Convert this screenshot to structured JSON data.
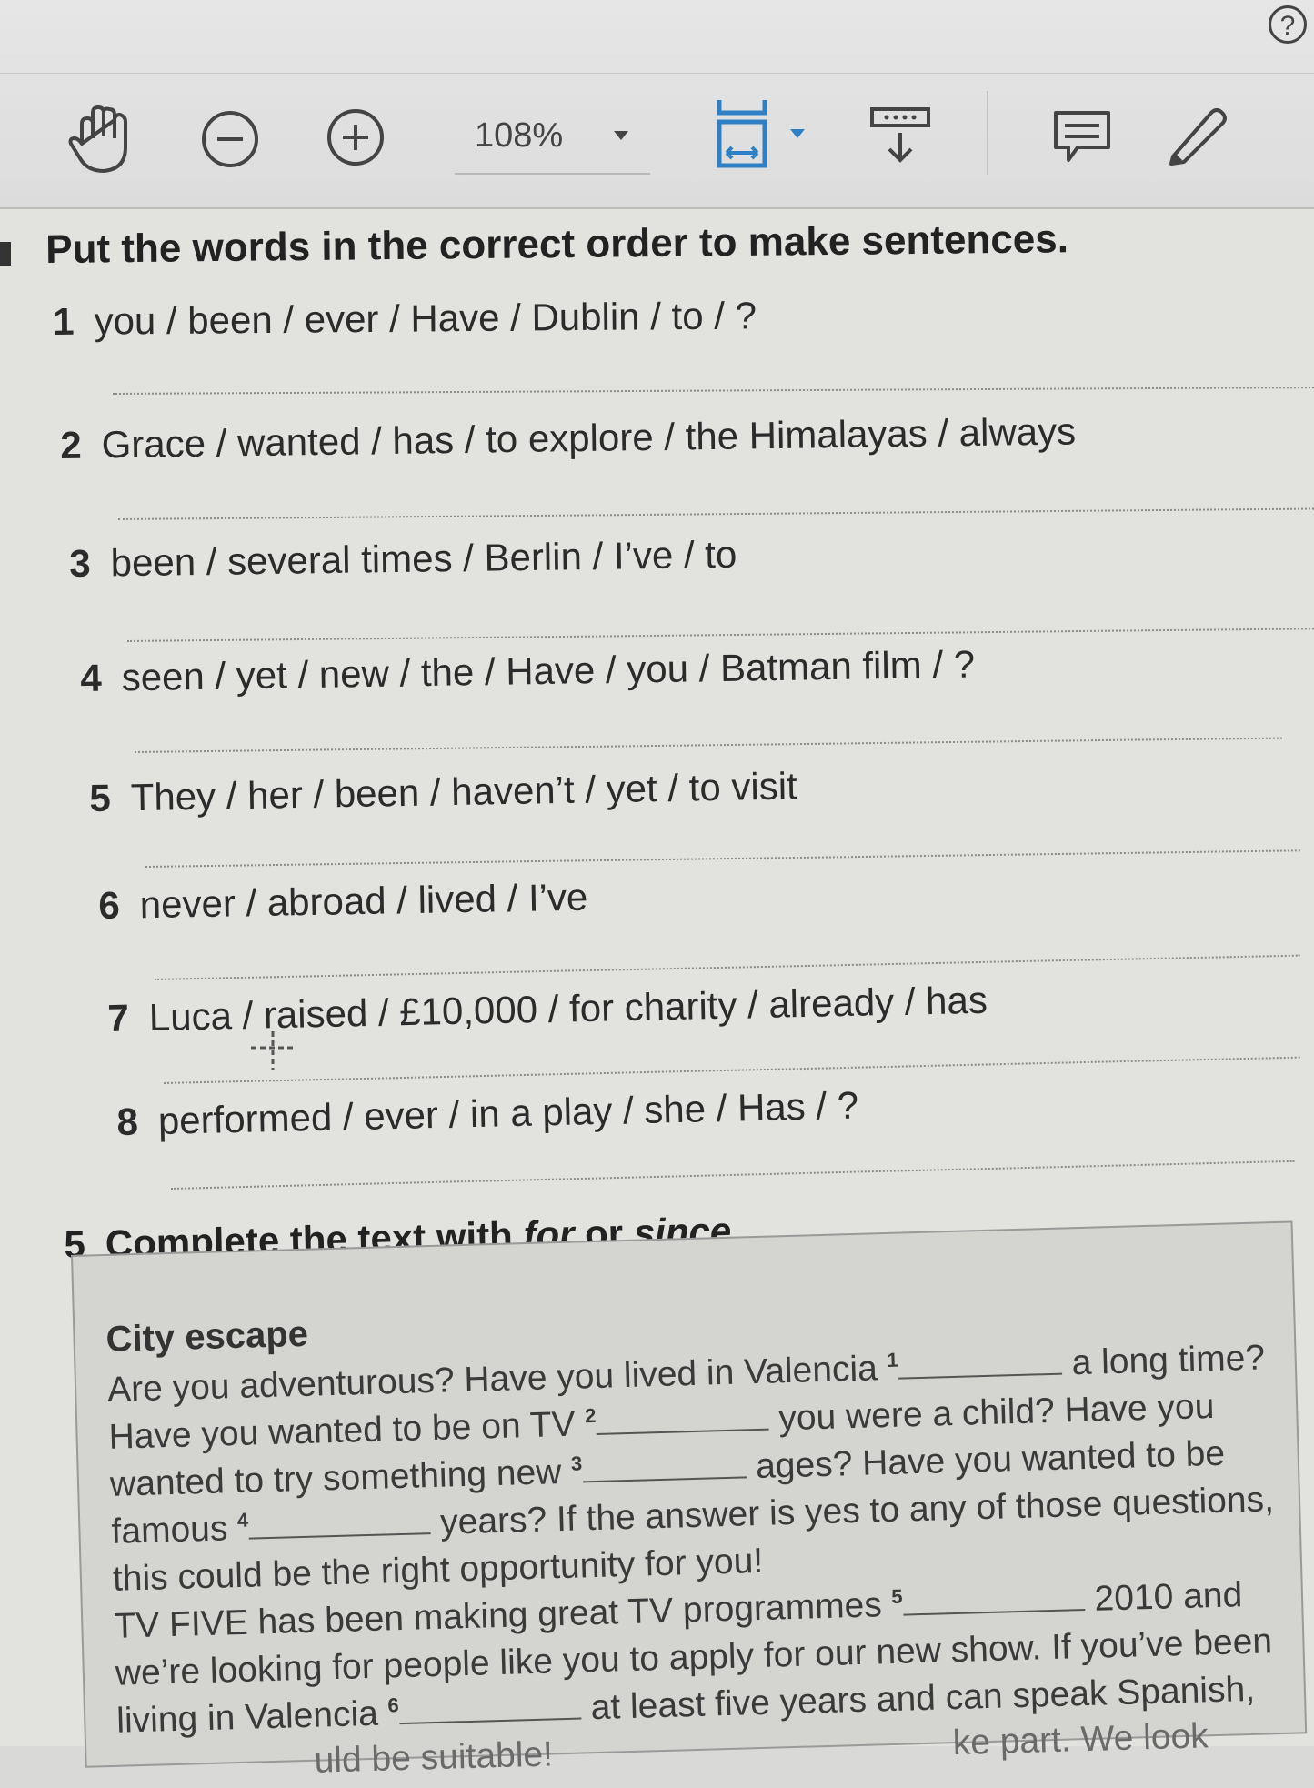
{
  "toolbar": {
    "zoom": "108%",
    "help": "?"
  },
  "exercise4": {
    "instruction": "Put the words in the correct order to make sentences.",
    "items": [
      {
        "num": "1",
        "text": "you / been / ever / Have / Dublin / to / ?"
      },
      {
        "num": "2",
        "text": "Grace / wanted / has / to explore / the Himalayas / always"
      },
      {
        "num": "3",
        "text": "been / several times / Berlin / I’ve / to"
      },
      {
        "num": "4",
        "text": "seen / yet / new / the / Have / you / Batman film / ?"
      },
      {
        "num": "5",
        "text": "They / her / been / haven’t / yet / to visit"
      },
      {
        "num": "6",
        "text": "never / abroad / lived / I’ve"
      },
      {
        "num": "7",
        "text": "Luca / raised / £10,000 / for charity / already / has"
      },
      {
        "num": "8",
        "text": "performed / ever / in a play / she / Has / ?"
      }
    ]
  },
  "exercise5": {
    "num": "5",
    "instruction_pre": "Complete the text with ",
    "for": "for",
    "or": " or ",
    "since": "since",
    "end": ".",
    "title": "City escape",
    "lines": {
      "l1a": "Are you adventurous? Have you lived in Valencia ",
      "l1n": "1",
      "l1b": " a long time?",
      "l2a": "Have you wanted to be on TV ",
      "l2n": "2",
      "l2b": " you were a child? Have you",
      "l3a": "wanted to try something new ",
      "l3n": "3",
      "l3b": " ages? Have you wanted to be",
      "l4a": "famous ",
      "l4n": "4",
      "l4b": " years? If the answer is yes to any of those questions,",
      "l5": "this could be the right opportunity for you!",
      "l6a": "TV FIVE has been making great TV programmes ",
      "l6n": "5",
      "l6b": " 2010 and",
      "l7": "we’re looking for people like you to apply for our new show. If you’ve been",
      "l8a": "living in Valencia ",
      "l8n": "6",
      "l8b": " at least five years and can speak Spanish,",
      "l9a": "uld be suitable!",
      "l9b": "ke part. We look"
    }
  }
}
